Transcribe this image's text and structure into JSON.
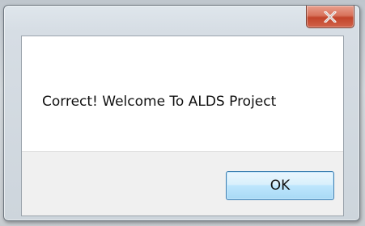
{
  "dialog": {
    "message": "Correct! Welcome To ALDS Project",
    "ok_label": "OK",
    "close_icon": "close-icon"
  },
  "colors": {
    "close_button": "#c84a30",
    "ok_button_border": "#3c7fb1",
    "content_background": "#ffffff"
  }
}
